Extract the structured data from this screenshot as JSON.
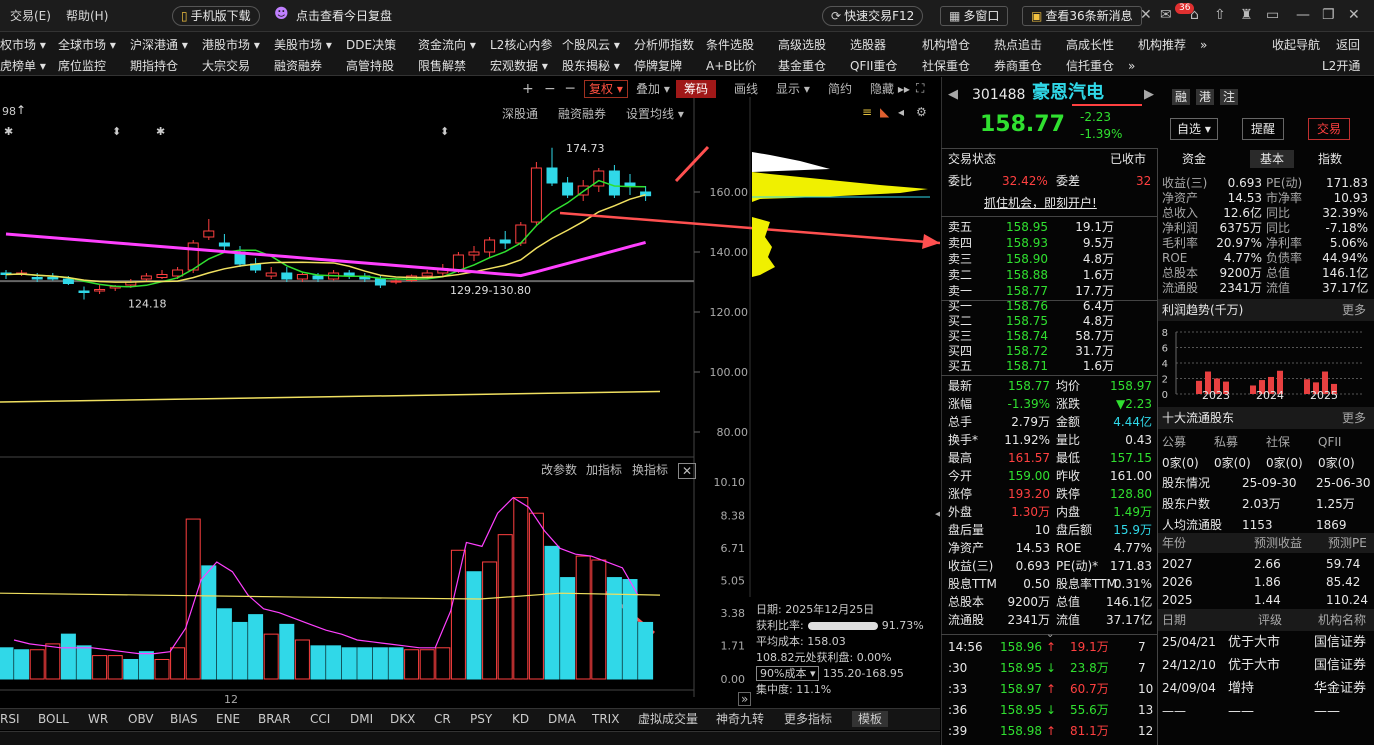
{
  "titlebar": {
    "trade": "交易(E)",
    "help": "帮助(H)",
    "mobile": "手机版下载",
    "review": "点击查看今日复盘",
    "quick": "快速交易F12",
    "multi": "多窗口",
    "news": "查看36条新消息",
    "badge": "36"
  },
  "menu_row1": [
    "权市场 ▾",
    "全球市场 ▾",
    "沪深港通 ▾",
    "港股市场 ▾",
    "美股市场 ▾",
    "DDE决策",
    "资金流向 ▾",
    "L2核心内参",
    "个股风云 ▾",
    "分析师指数",
    "条件选股",
    "高级选股",
    "选股器",
    "机构增仓",
    "热点追击",
    "高成长性",
    "机构推荐",
    "»",
    "收起导航",
    "返回"
  ],
  "menu_row2": [
    "虎榜单 ▾",
    "席位监控",
    "期指持仓",
    "大宗交易",
    "融资融券",
    "高管持股",
    "限售解禁",
    "宏观数据 ▾",
    "股东揭秘 ▾",
    "停牌复牌",
    "A+B比价",
    "基金重仓",
    "QFII重仓",
    "社保重仓",
    "券商重仓",
    "信托重仓",
    "»",
    "L2开通"
  ],
  "toolbar": {
    "fuquan": "复权 ▾",
    "diejia": "叠加 ▾",
    "chouma": "筹码",
    "huaxian": "画线",
    "xianshi": "显示 ▾",
    "jianjie": "简约",
    "yincang": "隐藏 ▸▸",
    "shgt": "深股通",
    "rzrq": "融资融券",
    "setma": "设置均线 ▾",
    "left_val": "98"
  },
  "price_axis": [
    "160.00",
    "140.00",
    "120.00",
    "100.00",
    "80.00"
  ],
  "ind_axis": [
    "10.10",
    "8.38",
    "6.71",
    "5.05",
    "3.38",
    "1.71",
    "0.00"
  ],
  "annotations": {
    "high": "174.73",
    "low": "124.18",
    "range": "129.29-130.80"
  },
  "ind_toolbar": {
    "params": "改参数",
    "add": "加指标",
    "switch": "换指标"
  },
  "chip": {
    "date": "日期: 2025年12月25日",
    "profit_ratio_lbl": "获利比率:",
    "profit_ratio": "91.73%",
    "avg_cost": "平均成本: 158.03",
    "profit_at": "108.82元处获利盘: 0.00%",
    "cost_sel": "90%成本 ▾",
    "cost_range": "135.20-168.95",
    "concentration": "集中度: 11.1%"
  },
  "x_label": "12",
  "bottom_tabs": [
    "RSI",
    "BOLL",
    "WR",
    "OBV",
    "BIAS",
    "ENE",
    "BRAR",
    "CCI",
    "DMI",
    "DKX",
    "CR",
    "PSY",
    "KD",
    "DMA",
    "TRIX",
    "虚拟成交量",
    "神奇九转",
    "更多指标",
    "模板"
  ],
  "stock": {
    "code": "301488",
    "name": "豪恩汽电",
    "price": "158.77",
    "change": "-2.23",
    "pct": "-1.39%",
    "rong": "融",
    "gang": "港",
    "zhu": "注",
    "zixuan": "自选 ▾",
    "tixing": "提醒",
    "jiaoyi": "交易"
  },
  "status": {
    "label": "交易状态",
    "value": "已收市",
    "weibi_lbl": "委比",
    "weibi": "32.42%",
    "weicha_lbl": "委差",
    "weicha": "32",
    "ad": "抓住机会，即刻开户!"
  },
  "asks": [
    {
      "l": "卖五",
      "p": "158.95",
      "v": "19.1万"
    },
    {
      "l": "卖四",
      "p": "158.93",
      "v": "9.5万"
    },
    {
      "l": "卖三",
      "p": "158.90",
      "v": "4.8万"
    },
    {
      "l": "卖二",
      "p": "158.88",
      "v": "1.6万"
    },
    {
      "l": "卖一",
      "p": "158.77",
      "v": "17.7万"
    }
  ],
  "bids": [
    {
      "l": "买一",
      "p": "158.76",
      "v": "6.4万"
    },
    {
      "l": "买二",
      "p": "158.75",
      "v": "4.8万"
    },
    {
      "l": "买三",
      "p": "158.74",
      "v": "58.7万"
    },
    {
      "l": "买四",
      "p": "158.72",
      "v": "31.7万"
    },
    {
      "l": "买五",
      "p": "158.71",
      "v": "1.6万"
    }
  ],
  "quote": [
    {
      "a": "最新",
      "b": "158.77",
      "bc": "g",
      "c": "均价",
      "d": "158.97",
      "dc": "g"
    },
    {
      "a": "涨幅",
      "b": "-1.39%",
      "bc": "g",
      "c": "涨跌",
      "d": "▼2.23",
      "dc": "g"
    },
    {
      "a": "总手",
      "b": "2.79万",
      "bc": "w",
      "c": "金额",
      "d": "4.44亿",
      "dc": "c"
    },
    {
      "a": "换手*",
      "b": "11.92%",
      "bc": "w",
      "c": "量比",
      "d": "0.43",
      "dc": "w"
    },
    {
      "a": "最高",
      "b": "161.57",
      "bc": "r",
      "c": "最低",
      "d": "157.15",
      "dc": "g"
    },
    {
      "a": "今开",
      "b": "159.00",
      "bc": "g",
      "c": "昨收",
      "d": "161.00",
      "dc": "w"
    },
    {
      "a": "涨停",
      "b": "193.20",
      "bc": "r",
      "c": "跌停",
      "d": "128.80",
      "dc": "g"
    },
    {
      "a": "外盘",
      "b": "1.30万",
      "bc": "r",
      "c": "内盘",
      "d": "1.49万",
      "dc": "g"
    },
    {
      "a": "盘后量",
      "b": "10",
      "bc": "w",
      "c": "盘后额",
      "d": "15.9万",
      "dc": "c"
    },
    {
      "a": "净资产",
      "b": "14.53",
      "bc": "w",
      "c": "ROE",
      "d": "4.77%",
      "dc": "w"
    },
    {
      "a": "收益(三)",
      "b": "0.693",
      "bc": "w",
      "c": "PE(动)*",
      "d": "171.83",
      "dc": "w"
    },
    {
      "a": "股息TTM",
      "b": "0.50",
      "bc": "w",
      "c": "股息率TTM",
      "d": "0.31%",
      "dc": "w"
    },
    {
      "a": "总股本",
      "b": "9200万",
      "bc": "w",
      "c": "总值",
      "d": "146.1亿",
      "dc": "w"
    },
    {
      "a": "流通股",
      "b": "2341万",
      "bc": "w",
      "c": "流值",
      "d": "37.17亿",
      "dc": "w"
    }
  ],
  "ticks": [
    {
      "t": "14:56",
      "p": "158.96",
      "ar": "↑",
      "v": "19.1万",
      "n": "7"
    },
    {
      "t": ":30",
      "p": "158.95",
      "ar": "↓",
      "v": "23.8万",
      "n": "7"
    },
    {
      "t": ":33",
      "p": "158.97",
      "ar": "↑",
      "v": "60.7万",
      "n": "10"
    },
    {
      "t": ":36",
      "p": "158.95",
      "ar": "↓",
      "v": "55.6万",
      "n": "13"
    },
    {
      "t": ":39",
      "p": "158.98",
      "ar": "↑",
      "v": "81.1万",
      "n": "12"
    }
  ],
  "ftabs": [
    "资金",
    "基本",
    "指数"
  ],
  "fund": [
    {
      "a": "收益(三)",
      "b": "0.693",
      "c": "PE(动)",
      "d": "171.83"
    },
    {
      "a": "净资产",
      "b": "14.53",
      "c": "市净率",
      "d": "10.93"
    },
    {
      "a": "总收入",
      "b": "12.6亿",
      "c": "同比",
      "d": "32.39%"
    },
    {
      "a": "净利润",
      "b": "6375万",
      "c": "同比",
      "d": "-7.18%"
    },
    {
      "a": "毛利率",
      "b": "20.97%",
      "c": "净利率",
      "d": "5.06%"
    },
    {
      "a": "ROE",
      "b": "4.77%",
      "c": "负债率",
      "d": "44.94%"
    },
    {
      "a": "总股本",
      "b": "9200万",
      "c": "总值",
      "d": "146.1亿"
    },
    {
      "a": "流通股",
      "b": "2341万",
      "c": "流值",
      "d": "37.17亿"
    }
  ],
  "profit": {
    "title": "利润趋势(千万)",
    "more": "更多",
    "y": [
      "8",
      "6",
      "4",
      "2",
      "0"
    ],
    "x": [
      "2023",
      "2024",
      "2025"
    ],
    "values": [
      1.7,
      2.9,
      2.0,
      1.6,
      1.1,
      1.8,
      2.2,
      3.0,
      1.9,
      1.5,
      2.9,
      1.3
    ]
  },
  "top10": {
    "title": "十大流通股东",
    "more": "更多",
    "heads": [
      "公募",
      "私募",
      "社保",
      "QFII"
    ],
    "vals": [
      "0家(0)",
      "0家(0)",
      "0家(0)",
      "0家(0)"
    ],
    "rows": [
      {
        "a": "股东情况",
        "b": "25-09-30",
        "c": "25-06-30"
      },
      {
        "a": "股东户数",
        "b": "2.03万",
        "c": "1.25万"
      },
      {
        "a": "人均流通股",
        "b": "1153",
        "c": "1869"
      }
    ]
  },
  "forecast": {
    "heads": [
      "年份",
      "预测收益",
      "预测PE"
    ],
    "rows": [
      [
        "2027",
        "2.66",
        "59.74"
      ],
      [
        "2026",
        "1.86",
        "85.42"
      ],
      [
        "2025",
        "1.44",
        "110.24"
      ]
    ]
  },
  "rating": {
    "heads": [
      "日期",
      "评级",
      "机构名称"
    ],
    "rows": [
      [
        "25/04/21",
        "优于大市",
        "国信证券"
      ],
      [
        "24/12/10",
        "优于大市",
        "国信证券"
      ],
      [
        "24/09/04",
        "增持",
        "华金证券"
      ],
      [
        "——",
        "——",
        "——"
      ]
    ]
  },
  "colors": {
    "up": "#ff4040",
    "down": "#30e030",
    "cyan": "#30d8e8",
    "ma5": "#ffffff",
    "ma10": "#f0e060",
    "ma20": "#ff40ff",
    "ma60": "#30e030"
  }
}
